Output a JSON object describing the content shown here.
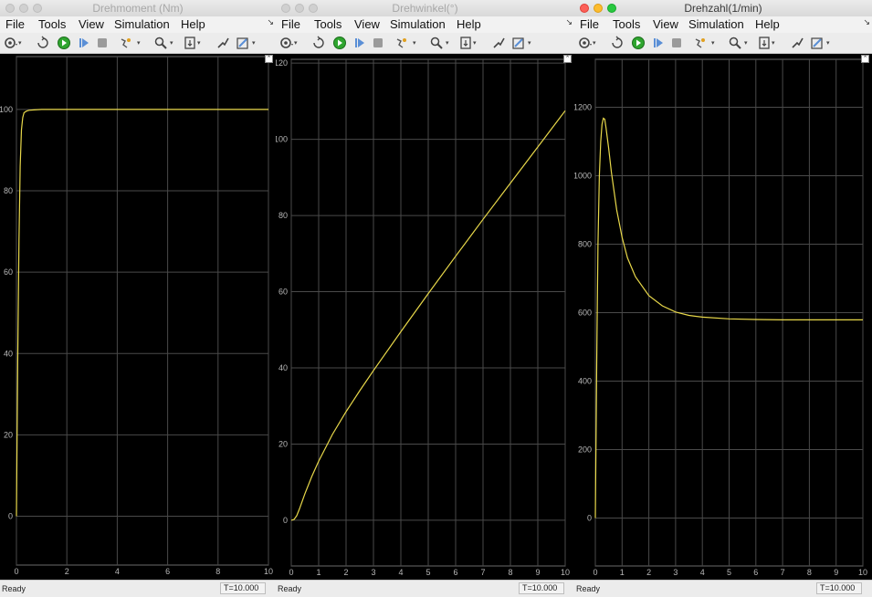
{
  "colors": {
    "trace": "#e8d84a",
    "plot_bg": "#000000",
    "grid": "#4a4a4a",
    "tick_text": "#b8b8b8"
  },
  "windows": [
    {
      "id": "w1",
      "title": "Drehmoment (Nm)",
      "active": false,
      "menu": [
        "File",
        "Tools",
        "View",
        "Simulation",
        "Help"
      ],
      "toolbar_icons": [
        "settings-icon",
        "open-icon",
        "run-icon",
        "step-forward-icon",
        "stop-icon",
        "highlight-icon",
        "zoom-icon",
        "fit-icon",
        "cursor-icon",
        "style-icon"
      ],
      "status": {
        "text": "Ready",
        "time": "T=10.000"
      },
      "chart_data": {
        "type": "line",
        "xlim": [
          0,
          10
        ],
        "ylim": [
          -12,
          113
        ],
        "xticks": [
          0,
          2,
          4,
          6,
          8,
          10
        ],
        "yticks": [
          0,
          20,
          40,
          60,
          80,
          100
        ],
        "grid": true,
        "series": [
          {
            "x": [
              0,
              0.05,
              0.1,
              0.15,
              0.2,
              0.25,
              0.3,
              0.4,
              0.5,
              0.7,
              1.0,
              2,
              4,
              6,
              8,
              10
            ],
            "y": [
              0,
              38,
              68,
              86,
              95,
              98,
              99.2,
              99.6,
              99.8,
              99.9,
              100,
              100,
              100,
              100,
              100,
              100
            ]
          }
        ]
      }
    },
    {
      "id": "w2",
      "title": "Drehwinkel(°)",
      "active": false,
      "menu": [
        "File",
        "Tools",
        "View",
        "Simulation",
        "Help"
      ],
      "toolbar_icons": [
        "settings-icon",
        "open-icon",
        "run-icon",
        "step-forward-icon",
        "stop-icon",
        "highlight-icon",
        "zoom-icon",
        "fit-icon",
        "cursor-icon",
        "style-icon"
      ],
      "status": {
        "text": "Ready",
        "time": "T=10.000"
      },
      "chart_data": {
        "type": "line",
        "xlim": [
          0,
          10
        ],
        "ylim": [
          -12,
          121
        ],
        "xticks": [
          0,
          1,
          2,
          3,
          4,
          5,
          6,
          7,
          8,
          9,
          10
        ],
        "yticks": [
          0,
          20,
          40,
          60,
          80,
          100,
          120
        ],
        "grid": true,
        "series": [
          {
            "x": [
              0,
              0.1,
              0.2,
              0.3,
              0.5,
              0.75,
              1.0,
              1.5,
              2.0,
              2.5,
              3.0,
              4.0,
              5.0,
              6.0,
              7.0,
              8.0,
              9.0,
              10.0
            ],
            "y": [
              0,
              0.2,
              1.2,
              3.0,
              7.0,
              11.5,
              15.5,
              22.5,
              28.5,
              34.0,
              39.3,
              49.5,
              59.5,
              69.3,
              79.0,
              88.5,
              98.0,
              107.5
            ]
          }
        ]
      }
    },
    {
      "id": "w3",
      "title": "Drehzahl(1/min)",
      "active": true,
      "menu": [
        "File",
        "Tools",
        "View",
        "Simulation",
        "Help"
      ],
      "toolbar_icons": [
        "settings-icon",
        "open-icon",
        "run-icon",
        "step-forward-icon",
        "stop-icon",
        "highlight-icon",
        "zoom-icon",
        "fit-icon",
        "cursor-icon",
        "style-icon"
      ],
      "status": {
        "text": "Ready",
        "time": "T=10.000"
      },
      "chart_data": {
        "type": "line",
        "xlim": [
          0,
          10
        ],
        "ylim": [
          -140,
          1340
        ],
        "xticks": [
          0,
          1,
          2,
          3,
          4,
          5,
          6,
          7,
          8,
          9,
          10
        ],
        "yticks": [
          0,
          200,
          400,
          600,
          800,
          1000,
          1200
        ],
        "grid": true,
        "series": [
          {
            "x": [
              0,
              0.05,
              0.1,
              0.15,
              0.2,
              0.25,
              0.3,
              0.35,
              0.4,
              0.5,
              0.6,
              0.8,
              1.0,
              1.2,
              1.5,
              2.0,
              2.5,
              3.0,
              3.5,
              4.0,
              5.0,
              6.0,
              7.0,
              8.0,
              9.0,
              10.0
            ],
            "y": [
              0,
              450,
              800,
              1000,
              1100,
              1150,
              1168,
              1165,
              1140,
              1080,
              1010,
              900,
              820,
              760,
              705,
              650,
              620,
              602,
              592,
              587,
              582,
              580,
              579,
              579,
              579,
              579
            ]
          }
        ]
      }
    }
  ]
}
